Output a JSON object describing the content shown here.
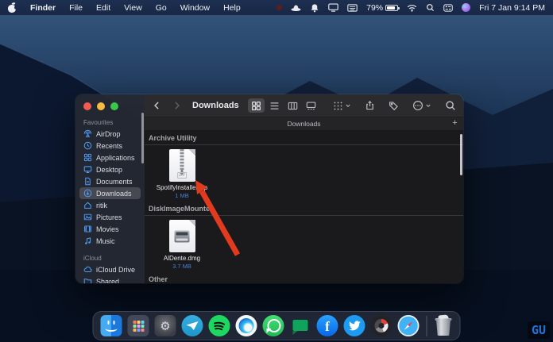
{
  "menubar": {
    "app_menu": "Finder",
    "menus": [
      "File",
      "Edit",
      "View",
      "Go",
      "Window",
      "Help"
    ],
    "battery_percent": "79%",
    "clock": "Fri 7 Jan 9:14 PM"
  },
  "window": {
    "toolbar": {
      "title": "Downloads"
    },
    "tab_bar": {
      "active_tab": "Downloads",
      "new_tab": "+"
    },
    "sidebar": {
      "favourites_title": "Favourites",
      "icloud_title": "iCloud",
      "favourites": [
        {
          "label": "AirDrop"
        },
        {
          "label": "Recents"
        },
        {
          "label": "Applications"
        },
        {
          "label": "Desktop"
        },
        {
          "label": "Documents"
        },
        {
          "label": "Downloads"
        },
        {
          "label": "ritik"
        },
        {
          "label": "Pictures"
        },
        {
          "label": "Movies"
        },
        {
          "label": "Music"
        }
      ],
      "icloud": [
        {
          "label": "iCloud Drive"
        },
        {
          "label": "Shared"
        }
      ]
    },
    "content": {
      "groups": [
        {
          "header": "Archive Utility",
          "file": {
            "name": "SpotifyInstaller.zip",
            "size": "1 MB",
            "badge": "ZIP"
          }
        },
        {
          "header": "DiskImageMounter",
          "file": {
            "name": "AlDente.dmg",
            "size": "3.7 MB"
          }
        },
        {
          "header": "Other"
        }
      ]
    }
  },
  "dock_apps": [
    "Finder",
    "Launchpad",
    "System Preferences",
    "Telegram",
    "Spotify",
    "Microsoft Edge",
    "WhatsApp",
    "Google Chat",
    "Facebook",
    "Twitter",
    "Utility App",
    "Safari",
    "Trash"
  ],
  "watermark": "GU",
  "colors": {
    "sidebar_icon_blue": "#4f9df8",
    "arrow_red": "#e23a1e",
    "file_size_blue": "#4a7fd9"
  }
}
